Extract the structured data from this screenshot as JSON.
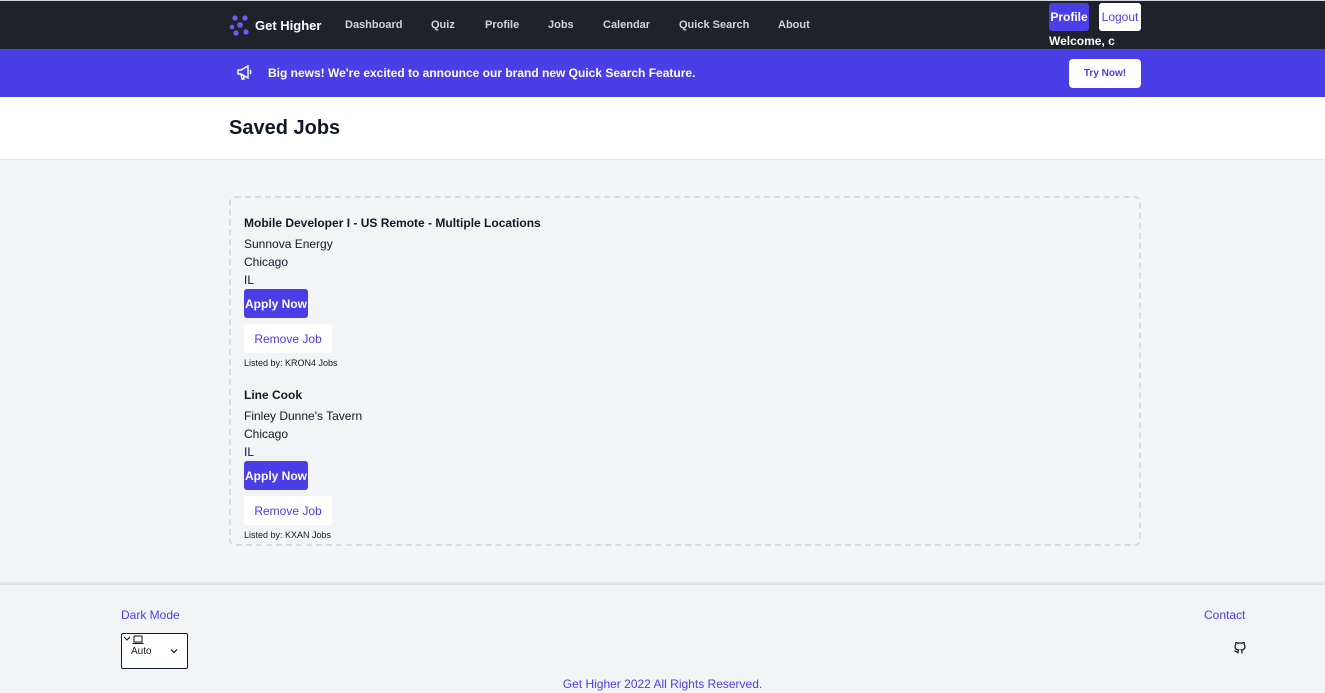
{
  "brand": {
    "name": "Get Higher"
  },
  "nav": {
    "items": [
      "Dashboard",
      "Quiz",
      "Profile",
      "Jobs",
      "Calendar",
      "Quick Search",
      "About"
    ]
  },
  "account": {
    "profile_label": "Profile",
    "logout_label": "Logout",
    "welcome": "Welcome, c"
  },
  "banner": {
    "text": "Big news! We're excited to announce our brand new Quick Search Feature.",
    "button": "Try Now!"
  },
  "page": {
    "title": "Saved Jobs"
  },
  "jobs": [
    {
      "title": "Mobile Developer I - US Remote - Multiple Locations",
      "company": "Sunnova Energy",
      "city": "Chicago",
      "state": "IL",
      "apply_label": "Apply Now",
      "remove_label": "Remove Job",
      "listed_by": "Listed by: KRON4 Jobs"
    },
    {
      "title": "Line Cook",
      "company": "Finley Dunne's Tavern",
      "city": "Chicago",
      "state": "IL",
      "apply_label": "Apply Now",
      "remove_label": "Remove Job",
      "listed_by": "Listed by: KXAN Jobs"
    }
  ],
  "footer": {
    "dark_mode_label": "Dark Mode",
    "theme_value": "Auto",
    "contact": "Contact",
    "copyright": "Get Higher 2022 All Rights Reserved."
  },
  "colors": {
    "accent": "#4a3ee6",
    "nav_bg": "#1f2329",
    "page_bg": "#f3f4f6"
  },
  "icons": {
    "brand": "logo-icon",
    "banner": "megaphone-icon",
    "theme": "laptop-icon",
    "github": "github-icon"
  }
}
